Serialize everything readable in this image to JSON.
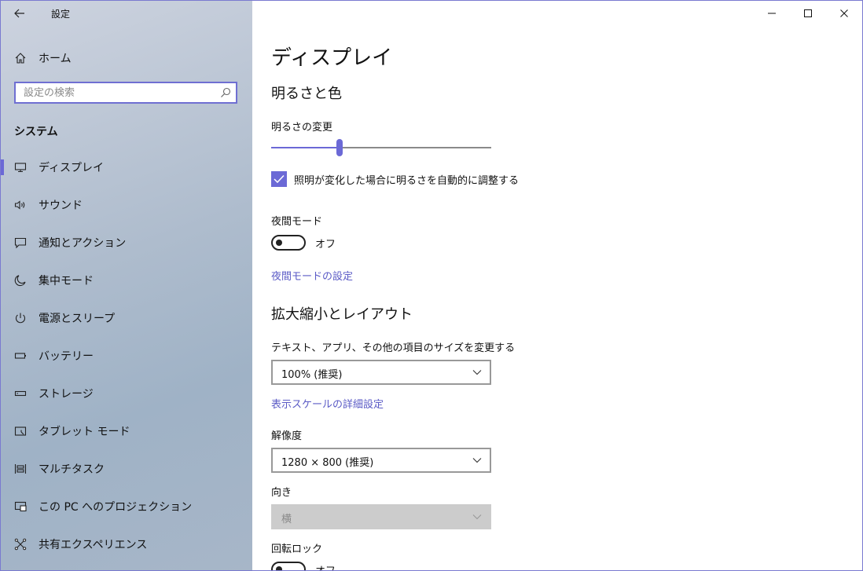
{
  "app": {
    "title": "設定"
  },
  "sidebar": {
    "home_label": "ホーム",
    "search_placeholder": "設定の検索",
    "section_heading": "システム",
    "items": [
      {
        "label": "ディスプレイ",
        "icon": "monitor-icon",
        "active": true
      },
      {
        "label": "サウンド",
        "icon": "speaker-icon"
      },
      {
        "label": "通知とアクション",
        "icon": "message-icon"
      },
      {
        "label": "集中モード",
        "icon": "moon-icon"
      },
      {
        "label": "電源とスリープ",
        "icon": "power-icon"
      },
      {
        "label": "バッテリー",
        "icon": "battery-icon"
      },
      {
        "label": "ストレージ",
        "icon": "storage-icon"
      },
      {
        "label": "タブレット モード",
        "icon": "tablet-icon"
      },
      {
        "label": "マルチタスク",
        "icon": "multitask-icon"
      },
      {
        "label": "この PC へのプロジェクション",
        "icon": "projection-icon"
      },
      {
        "label": "共有エクスペリエンス",
        "icon": "shared-icon"
      }
    ]
  },
  "main": {
    "page_title": "ディスプレイ",
    "brightness": {
      "heading": "明るさと色",
      "slider_label": "明るさの変更",
      "value_percent": 31,
      "auto_label": "照明が変化した場合に明るさを自動的に調整する",
      "auto_checked": true
    },
    "night_mode": {
      "label": "夜間モード",
      "state_label": "オフ",
      "settings_link": "夜間モードの設定"
    },
    "scale_layout": {
      "heading": "拡大縮小とレイアウト",
      "text_size_label": "テキスト、アプリ、その他の項目のサイズを変更する",
      "text_size_value": "100% (推奨)",
      "advanced_link": "表示スケールの詳細設定",
      "resolution_label": "解像度",
      "resolution_value": "1280 × 800 (推奨)",
      "orientation_label": "向き",
      "orientation_value": "横",
      "rotation_lock_label": "回転ロック",
      "rotation_lock_state": "オフ"
    }
  },
  "colors": {
    "accent": "#6b69d6",
    "link": "#5b5bc6"
  }
}
